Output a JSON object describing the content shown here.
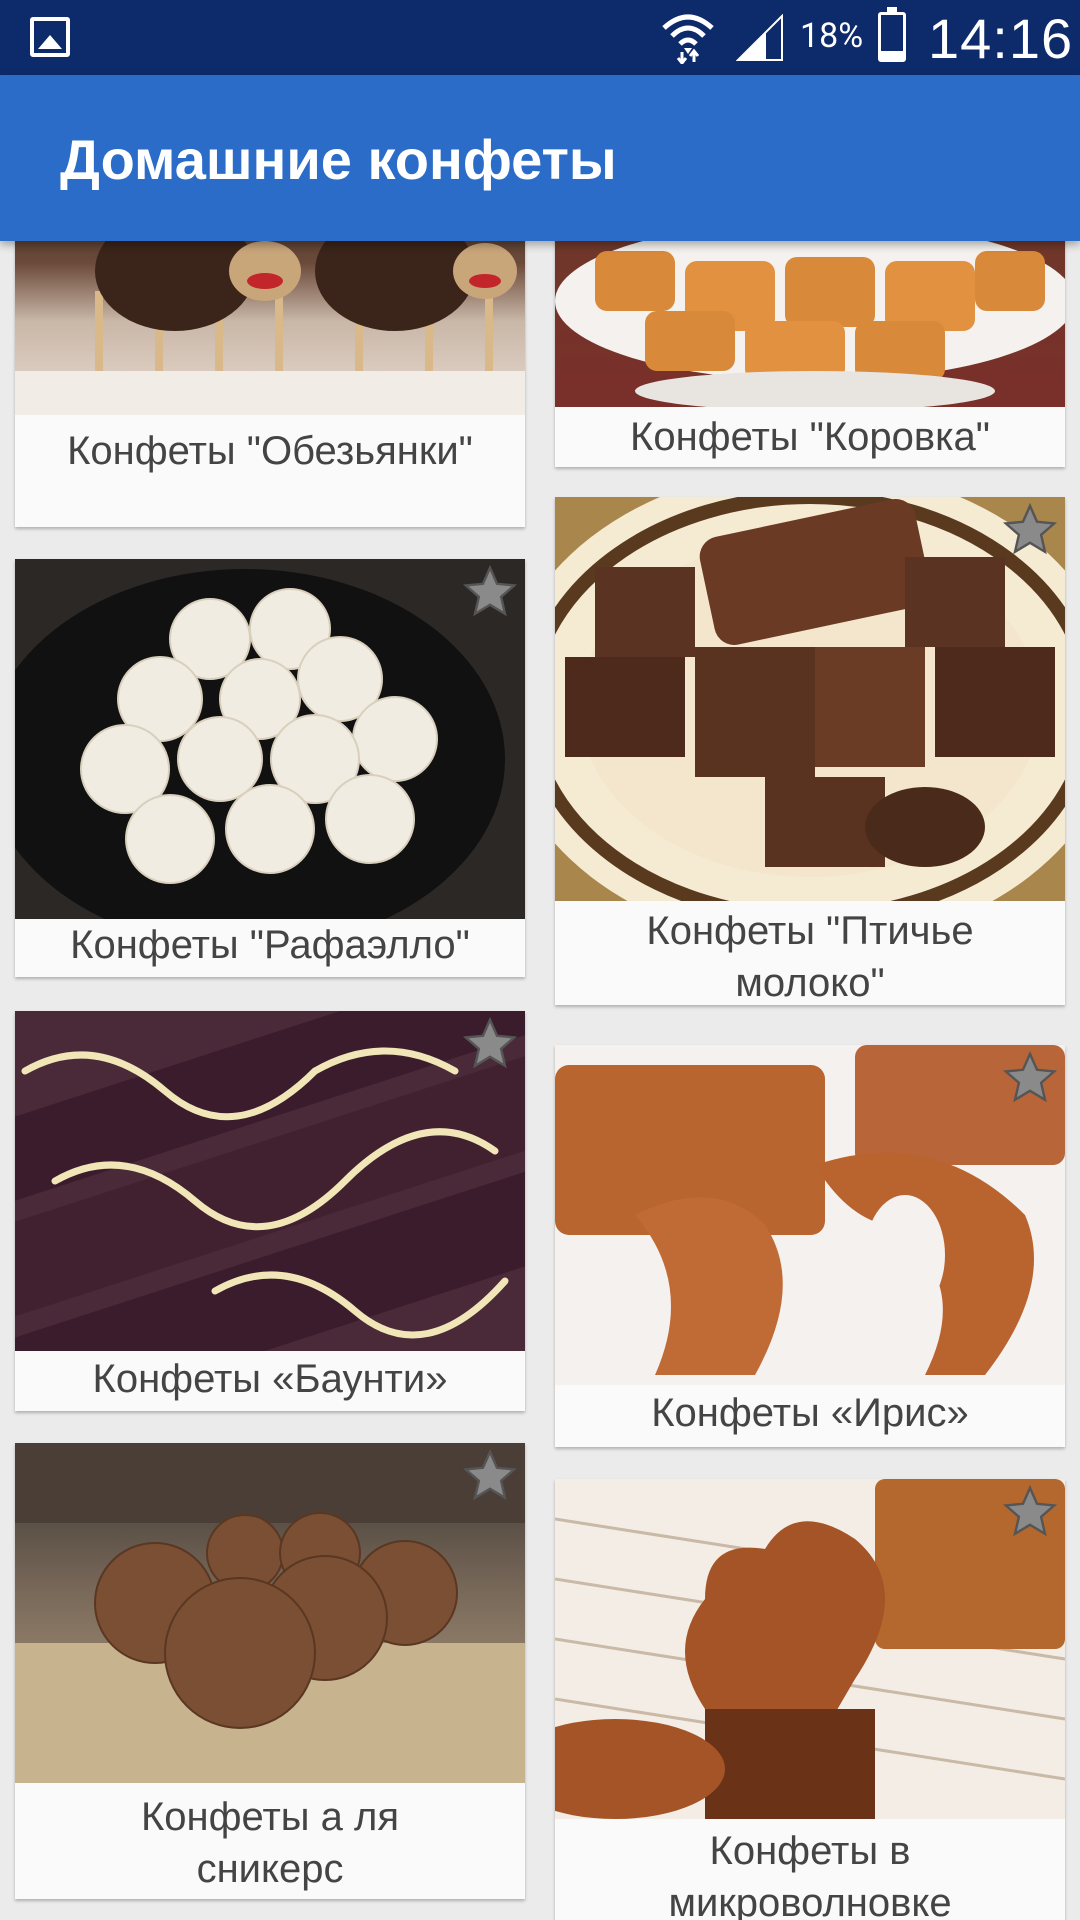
{
  "status_bar": {
    "battery_percent": "18%",
    "time": "14:16"
  },
  "app_bar": {
    "title": "Домашние конфеты"
  },
  "recipes": [
    {
      "label": "Конфеты \"Обезьянки\""
    },
    {
      "label": "Конфеты \"Коровка\""
    },
    {
      "label": "Конфеты \"Рафаэлло\""
    },
    {
      "label": "Конфеты \"Птичье молоко\""
    },
    {
      "label": "Конфеты «Баунти»"
    },
    {
      "label": "Конфеты «Ирис»"
    },
    {
      "label": "Конфеты а ля сникерс"
    },
    {
      "label": "Конфеты в микроволновке"
    }
  ]
}
